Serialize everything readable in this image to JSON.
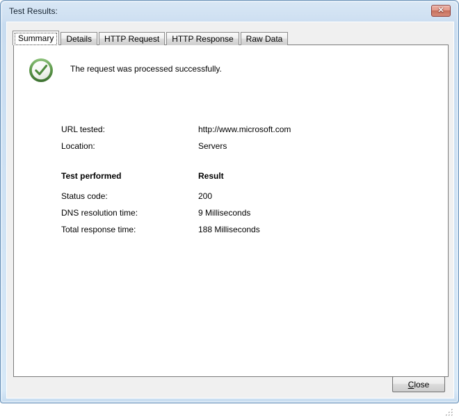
{
  "window": {
    "title": "Test Results:",
    "close_button": {
      "icon": "close-x-icon",
      "glyph": "✕"
    },
    "frame_color": "#cfe0f2",
    "border_color": "#6f94b8"
  },
  "tabs": [
    {
      "label": "Summary",
      "selected": true
    },
    {
      "label": "Details",
      "selected": false
    },
    {
      "label": "HTTP Request",
      "selected": false
    },
    {
      "label": "HTTP Response",
      "selected": false
    },
    {
      "label": "Raw Data",
      "selected": false
    }
  ],
  "summary": {
    "status": {
      "icon": "success-check-icon",
      "icon_color": "#4a8a3c",
      "message": "The request was processed successfully."
    },
    "info": [
      {
        "label": "URL tested:",
        "value": "http://www.microsoft.com"
      },
      {
        "label": "Location:",
        "value": "Servers"
      }
    ],
    "results_header": {
      "label": "Test performed",
      "value": "Result"
    },
    "results": [
      {
        "label": "Status code:",
        "value": "200"
      },
      {
        "label": "DNS resolution time:",
        "value": "9 Milliseconds"
      },
      {
        "label": "Total response time:",
        "value": "188 Milliseconds"
      }
    ]
  },
  "footer": {
    "close": {
      "accel": "C",
      "rest": "lose"
    },
    "resize_grip_icon": "resize-grip-icon"
  }
}
